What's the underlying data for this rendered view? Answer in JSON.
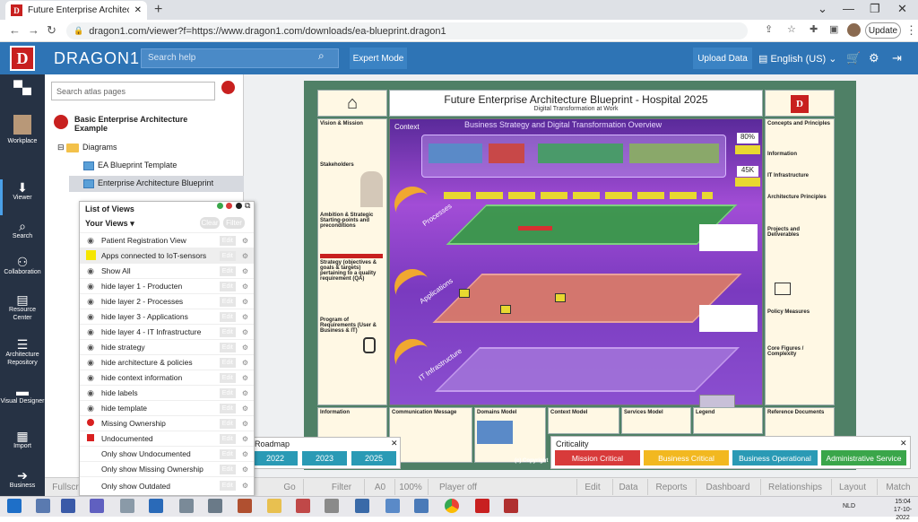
{
  "browser": {
    "tab_title": "Future Enterprise Architecture Bl",
    "tab_favicon": "D",
    "url": "dragon1.com/viewer?f=https://www.dragon1.com/downloads/ea-blueprint.dragon1",
    "update_label": "Update"
  },
  "header": {
    "logo_letter": "D",
    "brand": "DRAGON1",
    "search_placeholder": "Search help",
    "expert_mode": "Expert Mode",
    "upload_data": "Upload Data",
    "language": "English (US)"
  },
  "leftnav": [
    {
      "label": "",
      "icon": "home-icon"
    },
    {
      "label": "Workplace",
      "icon": "avatar"
    },
    {
      "label": "Viewer",
      "icon": "viewer-icon"
    },
    {
      "label": "Search",
      "icon": "search-icon"
    },
    {
      "label": "Collaboration",
      "icon": "collaboration-icon"
    },
    {
      "label": "Resource Center",
      "icon": "resource-center-icon"
    },
    {
      "label": "Architecture Repository",
      "icon": "repository-icon"
    },
    {
      "label": "Visual Designer",
      "icon": "visual-designer-icon"
    },
    {
      "label": "Import",
      "icon": "import-icon"
    },
    {
      "label": "Business",
      "icon": "business-icon"
    }
  ],
  "atlas": {
    "search_placeholder": "Search atlas pages",
    "root": "Basic Enterprise Architecture Example",
    "folder": "Diagrams",
    "items": [
      "EA Blueprint Template",
      "Enterprise Architecture Blueprint"
    ]
  },
  "list_of_views": {
    "title": "List of Views",
    "your_views": "Your Views",
    "clear": "Clear",
    "filter": "Filter",
    "edit": "Edit",
    "rows": [
      {
        "label": "Patient Registration View",
        "icon": "eye-icon"
      },
      {
        "label": "Apps connected to IoT-sensors",
        "icon": "yellow-square"
      },
      {
        "label": "Show All",
        "icon": "eye-icon"
      },
      {
        "label": "hide layer 1 - Producten",
        "icon": "eye-icon"
      },
      {
        "label": "hide layer 2 - Processes",
        "icon": "eye-icon"
      },
      {
        "label": "hide layer 3 - Applications",
        "icon": "eye-icon"
      },
      {
        "label": "hide layer 4 - IT Infrastructure",
        "icon": "eye-icon"
      },
      {
        "label": "hide strategy",
        "icon": "eye-icon"
      },
      {
        "label": "hide architecture & policies",
        "icon": "eye-icon"
      },
      {
        "label": "hide context information",
        "icon": "eye-icon"
      },
      {
        "label": "hide labels",
        "icon": "eye-icon"
      },
      {
        "label": "hide template",
        "icon": "eye-icon"
      },
      {
        "label": "Missing Ownership",
        "icon": "red-dot"
      },
      {
        "label": "Undocumented",
        "icon": "red-square"
      },
      {
        "label": "Only show Undocumented",
        "icon": ""
      },
      {
        "label": "Only show Missing Ownership",
        "icon": ""
      },
      {
        "label": "Only show Outdated",
        "icon": ""
      }
    ]
  },
  "blueprint": {
    "title": "Future Enterprise Architecture Blueprint - Hospital 2025",
    "subtitle": "Digital Transformation at Work",
    "context_label": "Context",
    "overview_title": "Business Strategy and Digital Transformation Overview",
    "kpi1": "80%",
    "kpi2": "45K",
    "layers": [
      "Processes",
      "Applications",
      "IT Infrastructure"
    ],
    "left_sections": [
      "Vision & Mission",
      "Stakeholders",
      "Ambition & Strategic Starting-points and preconditions",
      "Strategy (objectives & goals & targets) pertaining to a quality requirement (QA)",
      "Program of Requirements (User & Business & IT)",
      "Information"
    ],
    "right_sections": [
      "Concepts and Principles",
      "Information",
      "IT Infrastructure",
      "Architecture Principles",
      "Projects and Deliverables",
      "Policy Measures",
      "Core Figures / Complexity",
      "Reference Documents"
    ],
    "bottom_sections": [
      "Communication Message",
      "Domains Model",
      "Context Model",
      "Services Model",
      "Legend"
    ],
    "copyright": "(c) Copyright"
  },
  "roadmap": {
    "title": "Roadmap",
    "years": [
      "2022",
      "2023",
      "2025"
    ],
    "color": "#2a9ab5"
  },
  "criticality": {
    "title": "Criticality",
    "items": [
      {
        "label": "Mission Critical",
        "color": "#d83a3a"
      },
      {
        "label": "Business Critical",
        "color": "#f2b820"
      },
      {
        "label": "Business Operational",
        "color": "#2a9ab5"
      },
      {
        "label": "Administrative Service",
        "color": "#3aa64a"
      }
    ]
  },
  "bottombar": [
    "Fullscr",
    "Go",
    "Filter",
    "A0",
    "100%",
    "Player off",
    "Edit",
    "Data",
    "Reports",
    "Dashboard",
    "Relationships",
    "Layout",
    "Match"
  ],
  "taskbar": {
    "lang": "NLD",
    "time": "15:04",
    "date": "17-10-2022"
  }
}
